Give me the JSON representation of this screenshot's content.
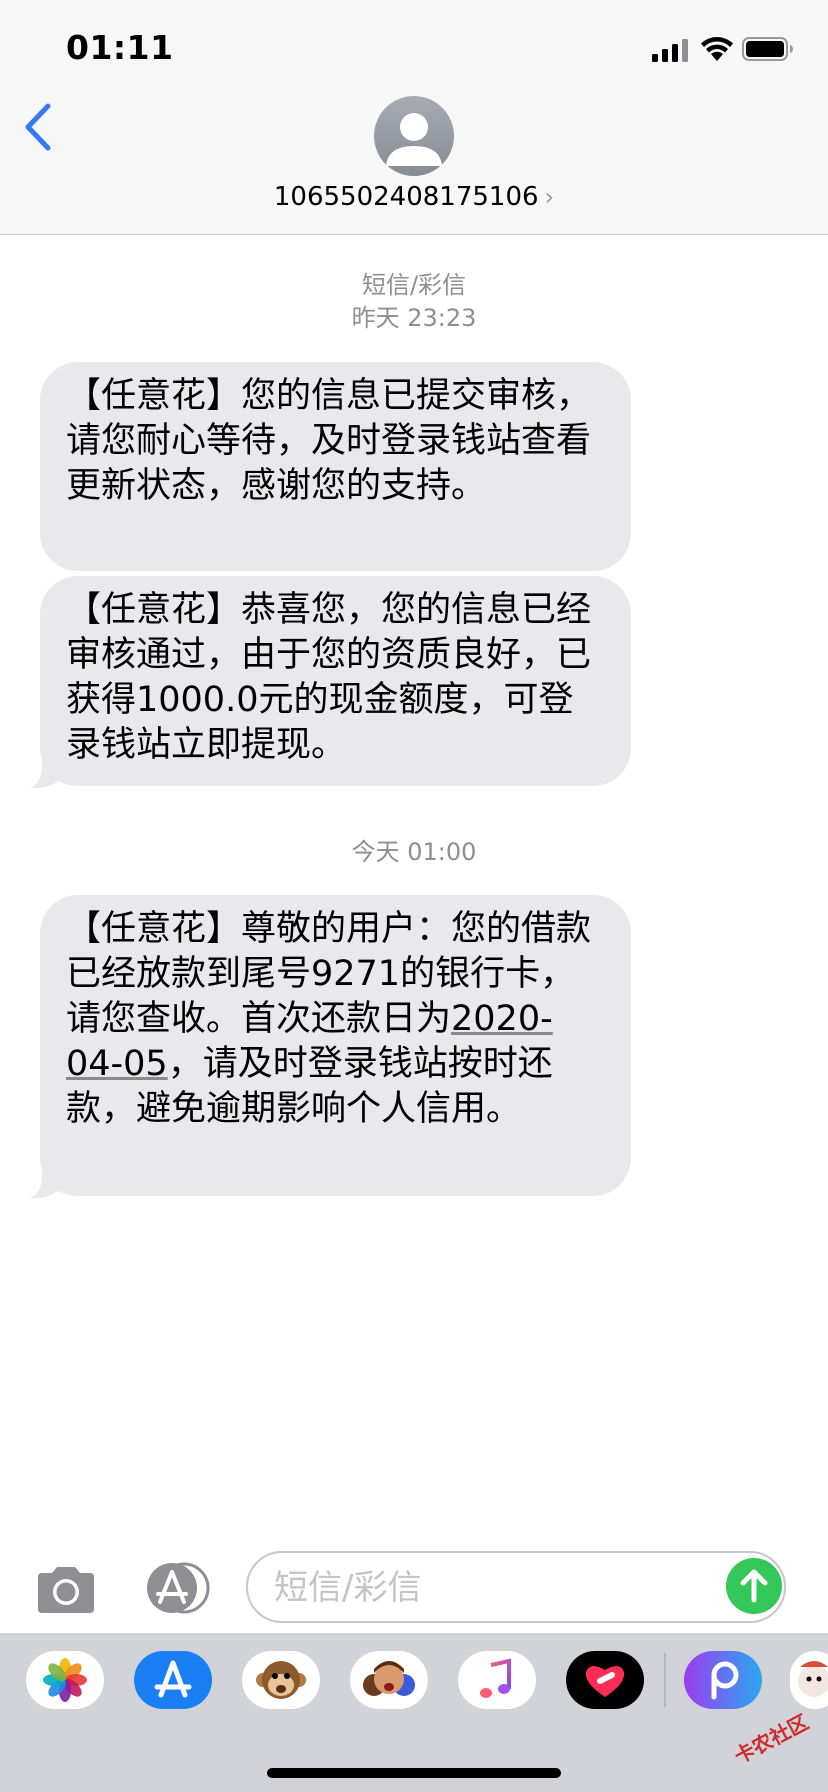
{
  "status": {
    "time": "01:11"
  },
  "header": {
    "contact": "1065502408175106",
    "chevron": "›"
  },
  "messages": {
    "label": "短信/彩信",
    "ts1": "昨天 23:23",
    "msg1": "【任意花】您的信息已提交审核，请您耐心等待，及时登录钱站查看更新状态，感谢您的支持。",
    "msg2": "【任意花】恭喜您，您的信息已经审核通过，由于您的资质良好，已获得1000.0元的现金额度，可登录钱站立即提现。",
    "ts2": "今天 01:00",
    "msg3_part1": "【任意花】尊敬的用户：您的借款已经放款到尾号9271的银行卡，请您查收。首次还款日为",
    "msg3_date": "2020-04-05",
    "msg3_part2": "，请及时登录钱站按时还款，避免逾期影响个人信用。"
  },
  "compose": {
    "placeholder": "短信/彩信"
  },
  "apps": [
    "photos-icon",
    "app-store-icon",
    "animoji-icon",
    "memoji-icon",
    "music-icon",
    "digital-touch-icon",
    "picsart-icon"
  ],
  "watermark": "卡农社区",
  "colors": {
    "accent": "#3478f6",
    "send": "#34c759",
    "bubble": "#e9e9eb"
  }
}
